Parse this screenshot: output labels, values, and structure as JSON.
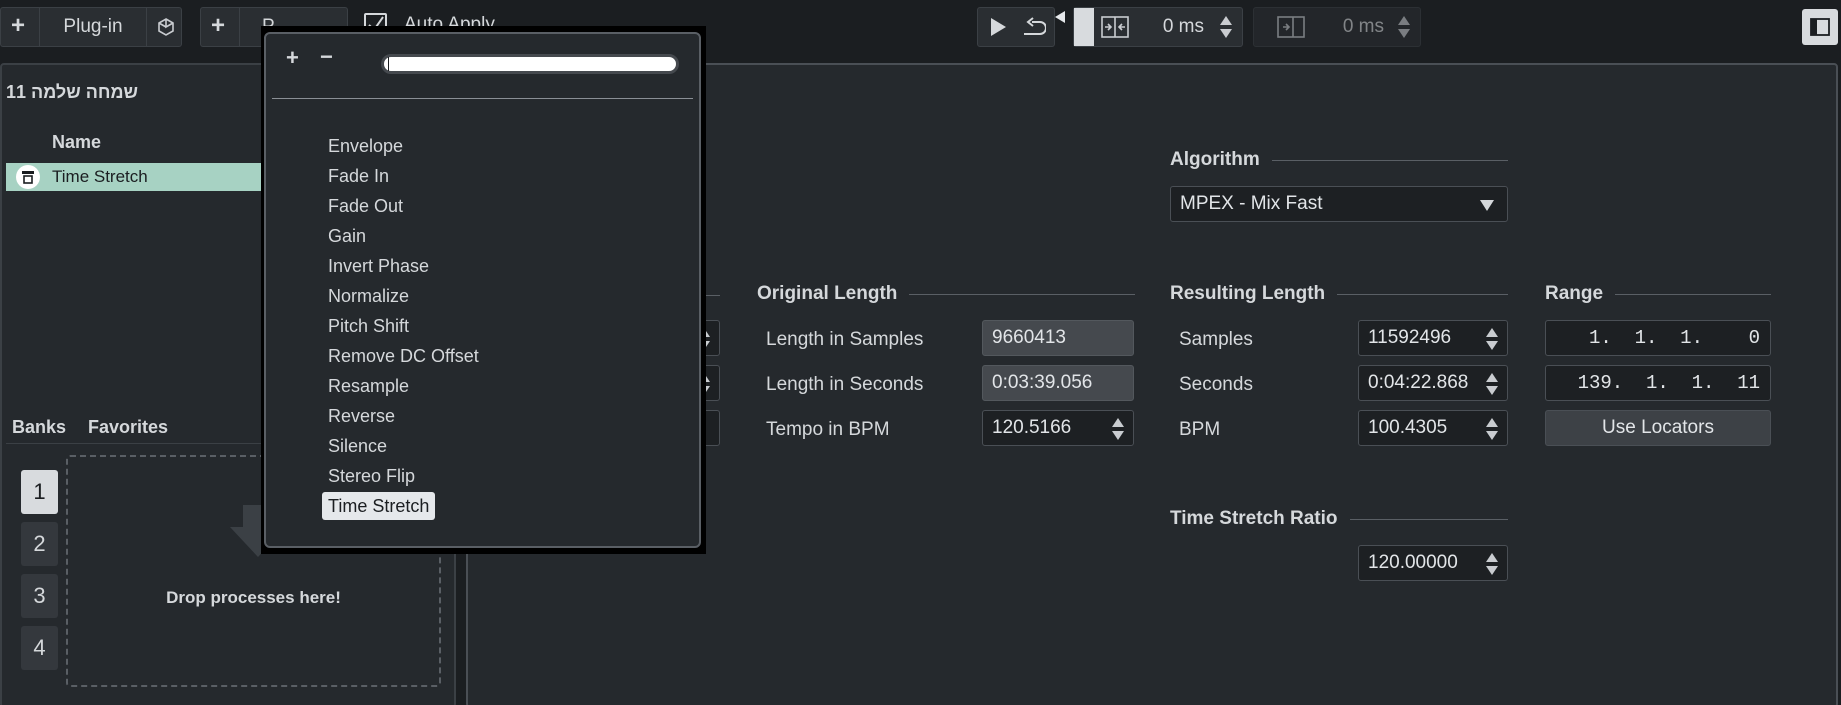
{
  "toolbar": {
    "plugin_label": "Plug-in",
    "preset_label": "P",
    "auto_apply_label": "Auto Apply",
    "pre_roll_value": "0 ms",
    "post_roll_value": "0 ms"
  },
  "left": {
    "title": "שמחה שלמה 11",
    "name_header": "Name",
    "process_item": "Time Stretch",
    "banks_tab": "Banks",
    "favorites_tab": "Favorites",
    "banks": [
      "1",
      "2",
      "3",
      "4"
    ],
    "drop_text": "Drop processes here!"
  },
  "menu": {
    "search_value": "",
    "items": [
      "Envelope",
      "Fade In",
      "Fade Out",
      "Gain",
      "Invert Phase",
      "Normalize",
      "Pitch Shift",
      "Remove DC Offset",
      "Resample",
      "Reverse",
      "Silence",
      "Stereo Flip",
      "Time Stretch"
    ],
    "selected": "Time Stretch"
  },
  "main": {
    "algorithm": {
      "title": "Algorithm",
      "value": "MPEX - Mix Fast"
    },
    "original": {
      "title": "Original Length",
      "samples_label": "Length in Samples",
      "samples_value": "9660413",
      "seconds_label": "Length in Seconds",
      "seconds_value": "0:03:39.056",
      "tempo_label": "Tempo in BPM",
      "tempo_value": "120.5166"
    },
    "resulting": {
      "title": "Resulting Length",
      "samples_label": "Samples",
      "samples_value": "11592496",
      "seconds_label": "Seconds",
      "seconds_value": "0:04:22.868",
      "bpm_label": "BPM",
      "bpm_value": "100.4305"
    },
    "range": {
      "title": "Range",
      "start": "1.  1.  1.    0",
      "end": "139.  1.  1.  11",
      "use_locators": "Use Locators"
    },
    "ratio": {
      "title": "Time Stretch Ratio",
      "value": "120.00000"
    }
  }
}
